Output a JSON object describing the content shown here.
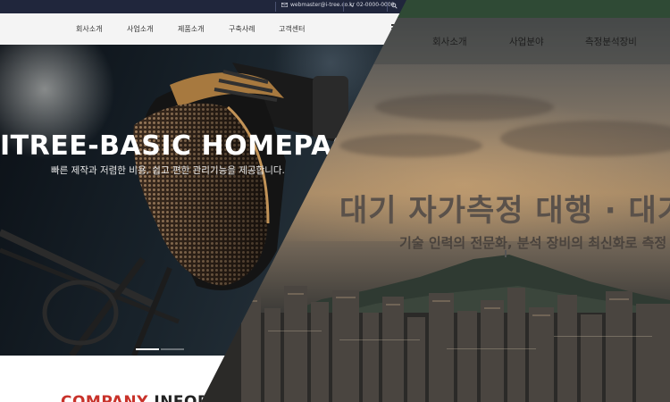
{
  "topbar": {
    "email": "webmaster@i-tree.co.kr",
    "phone": "02-0000-0000",
    "email_icon": "mail-icon",
    "phone_icon": "phone-icon",
    "search_icon": "search-icon"
  },
  "nav": {
    "items": [
      {
        "label": "회사소개"
      },
      {
        "label": "사업소개"
      },
      {
        "label": "제품소개"
      },
      {
        "label": "구축사례"
      },
      {
        "label": "고객센터"
      }
    ],
    "menu_icon": "hamburger-menu-icon"
  },
  "hero": {
    "title": "ITREE-BASIC HOMEPAGE",
    "subtitle": "빠른 제작과 저렴한 비용, 쉽고 편한 관리기능을 제공합니다.",
    "slides": 2,
    "active_slide": 1
  },
  "section": {
    "title_a": "COMPANY",
    "title_b": "INFOR"
  },
  "back_page": {
    "nav_items": [
      {
        "label": "회사소개"
      },
      {
        "label": "사업분야"
      },
      {
        "label": "측정분석장비"
      }
    ],
    "hero_title": "대기 자가측정 대행 · 대기 측",
    "hero_subtitle": "기술 인력의 전문화, 분석 장비의 최신화로 측정"
  },
  "colors": {
    "topbar_bg": "#20263c",
    "accent_red": "#c8322a",
    "back_green_bar": "#2f4a35"
  }
}
